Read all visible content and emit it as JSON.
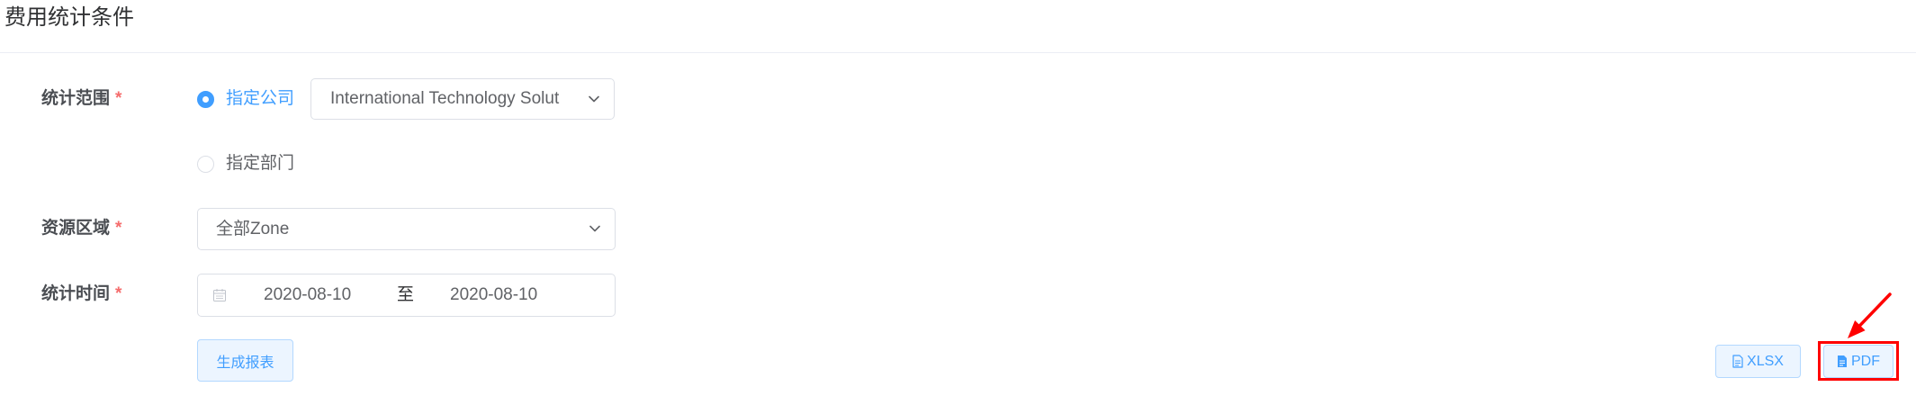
{
  "header": {
    "title": "费用统计条件"
  },
  "form": {
    "scope": {
      "label": "统计范围",
      "required_mark": "*",
      "options": [
        {
          "label": "指定公司",
          "checked": true
        },
        {
          "label": "指定部门",
          "checked": false
        }
      ],
      "company_select": {
        "value": "International Technology Solut",
        "icon": "chevron-down-icon"
      }
    },
    "region": {
      "label": "资源区域",
      "required_mark": "*",
      "select": {
        "value": "全部Zone",
        "icon": "chevron-down-icon"
      }
    },
    "period": {
      "label": "统计时间",
      "required_mark": "*",
      "icon": "calendar-icon",
      "start_date": "2020-08-10",
      "separator": "至",
      "end_date": "2020-08-10"
    },
    "generate_button": {
      "label": "生成报表"
    }
  },
  "export": {
    "xlsx_button": {
      "label": "XLSX",
      "icon": "document-icon"
    },
    "pdf_button": {
      "label": "PDF",
      "icon": "pdf-document-icon"
    }
  },
  "colors": {
    "primary": "#409eff",
    "required": "#f56c6c",
    "annotation": "#ff0000"
  }
}
